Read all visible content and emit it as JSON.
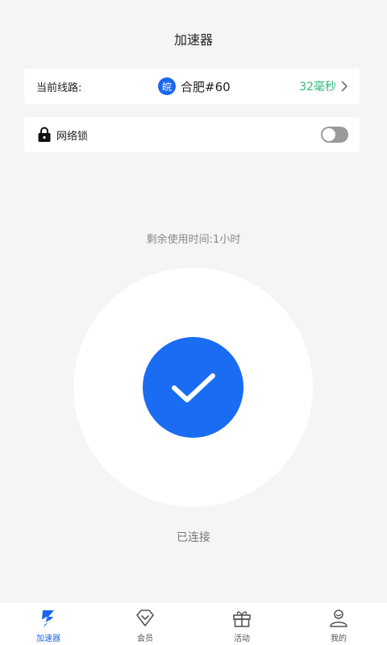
{
  "header": {
    "title": "加速器"
  },
  "line_card": {
    "label": "当前线路:",
    "region_badge": "皖",
    "node_name": "合肥#60",
    "ping": "32毫秒"
  },
  "lock_card": {
    "label": "网络锁",
    "toggle_on": false
  },
  "remaining_time": "剩余使用时间:1小时",
  "status": "已连接",
  "tabbar": {
    "items": [
      {
        "label": "加速器",
        "icon": "bolt-icon",
        "active": true
      },
      {
        "label": "会员",
        "icon": "diamond-heart-icon",
        "active": false
      },
      {
        "label": "活动",
        "icon": "gift-icon",
        "active": false
      },
      {
        "label": "我的",
        "icon": "user-icon",
        "active": false
      }
    ]
  },
  "colors": {
    "accent": "#1a66f0",
    "ping": "#2dbb7a",
    "background": "#f5f5f5"
  }
}
